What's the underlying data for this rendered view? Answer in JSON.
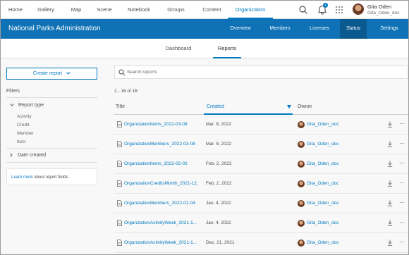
{
  "topnav": {
    "items": [
      {
        "label": "Home",
        "active": false
      },
      {
        "label": "Gallery",
        "active": false
      },
      {
        "label": "Map",
        "active": false
      },
      {
        "label": "Scene",
        "active": false
      },
      {
        "label": "Notebook",
        "active": false
      },
      {
        "label": "Groups",
        "active": false
      },
      {
        "label": "Content",
        "active": false
      },
      {
        "label": "Organization",
        "active": true
      }
    ],
    "notification_count": "1",
    "user": {
      "name": "Gita Oden",
      "username": "Gita_Oden_doc"
    }
  },
  "org": {
    "title": "National Parks Administration",
    "tabs": [
      {
        "label": "Overview",
        "active": false
      },
      {
        "label": "Members",
        "active": false
      },
      {
        "label": "Licenses",
        "active": false
      },
      {
        "label": "Status",
        "active": true
      },
      {
        "label": "Settings",
        "active": false
      }
    ]
  },
  "subtabs": [
    {
      "label": "Dashboard",
      "active": false
    },
    {
      "label": "Reports",
      "active": true
    }
  ],
  "sidebar": {
    "create_button": "Create report",
    "filters_title": "Filters",
    "report_type": {
      "label": "Report type",
      "options": [
        "Activity",
        "Credit",
        "Member",
        "Item"
      ]
    },
    "date_created": "Date created",
    "learn_more": {
      "link": "Learn more",
      "text": " about report fields."
    }
  },
  "main": {
    "search_placeholder": "Search reports",
    "count": "1 - 16 of 16",
    "columns": {
      "title": "Title",
      "created": "Created",
      "owner": "Owner"
    },
    "rows": [
      {
        "title": "OrganizationItems_2022-03-08",
        "created": "Mar. 8, 2022",
        "owner": "Gita_Oden_doc"
      },
      {
        "title": "OrganizationMembers_2022-03-08",
        "created": "Mar. 8, 2022",
        "owner": "Gita_Oden_doc"
      },
      {
        "title": "OrganizationItems_2022-02-02",
        "created": "Feb. 2, 2022",
        "owner": "Gita_Oden_doc"
      },
      {
        "title": "OrganizationCreditsMonth_2021-12...",
        "created": "Feb. 2, 2022",
        "owner": "Gita_Oden_doc"
      },
      {
        "title": "OrganizationMembers_2022-01-04",
        "created": "Jan. 4, 2022",
        "owner": "Gita_Oden_doc"
      },
      {
        "title": "OrganizationActivityWeek_2021-1...",
        "created": "Jan. 4, 2022",
        "owner": "Gita_Oden_doc"
      },
      {
        "title": "OrganizationActivityWeek_2021-1...",
        "created": "Dec. 21, 2021",
        "owner": "Gita_Oden_doc"
      }
    ]
  },
  "colors": {
    "accent": "#0079c1",
    "header": "#0f72b6",
    "header_active": "#0b5a8f"
  }
}
